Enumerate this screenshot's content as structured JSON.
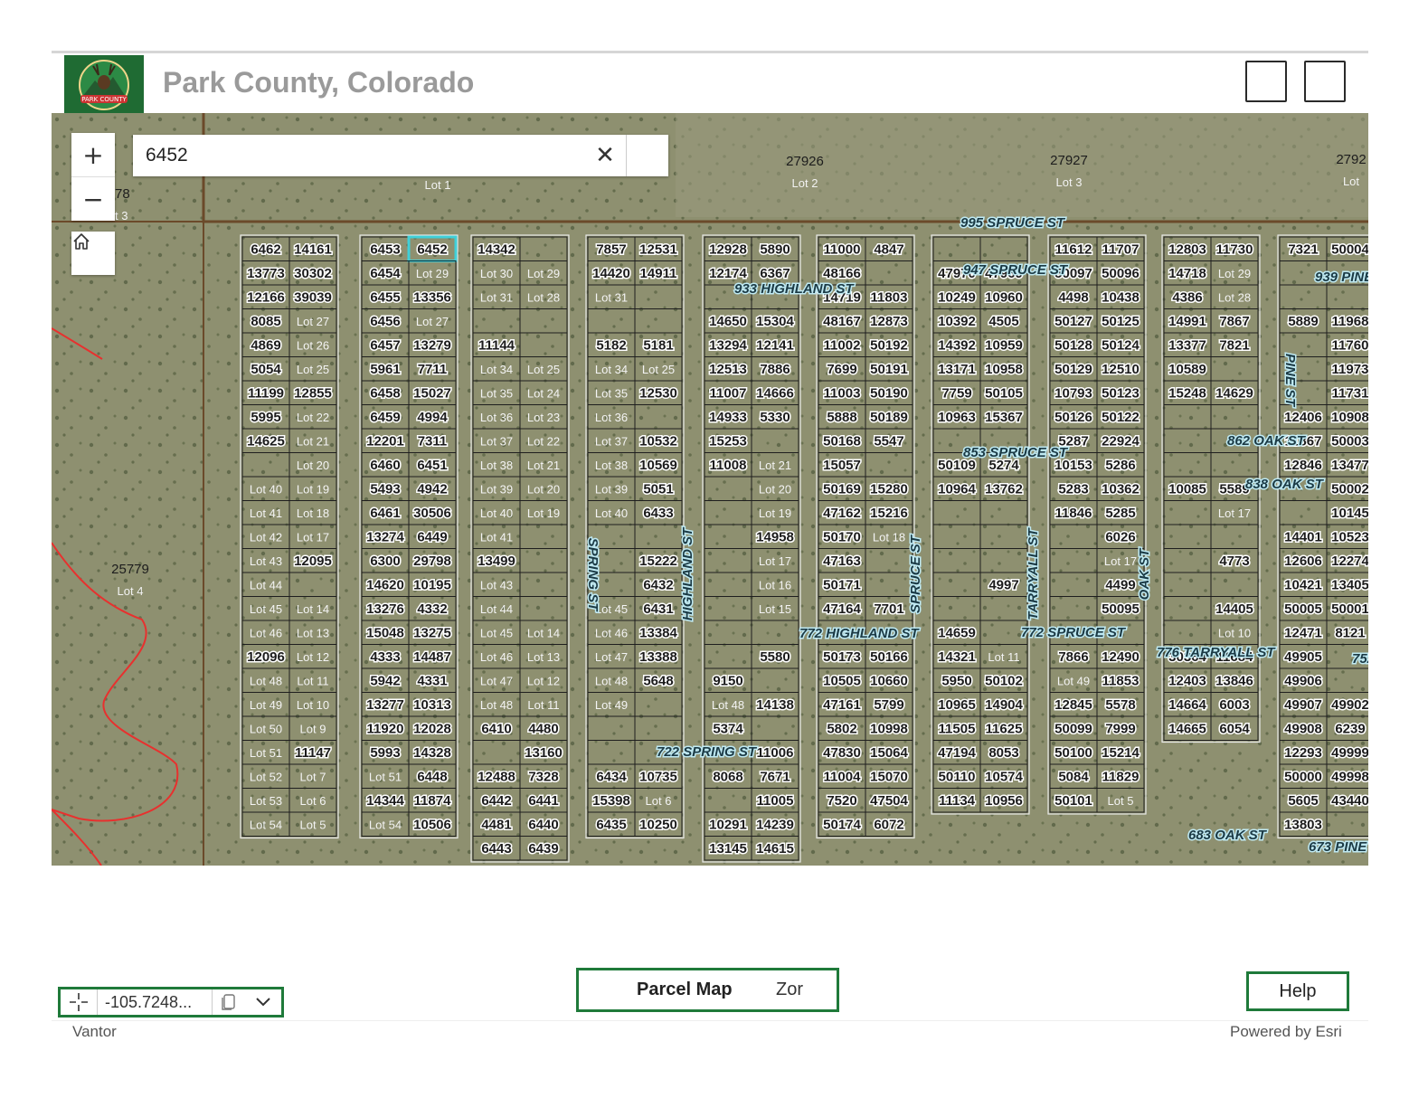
{
  "header": {
    "title": "Park County, Colorado",
    "logo_text": "PARK COUNTY"
  },
  "map": {
    "search": {
      "value": "6452",
      "placeholder": ""
    },
    "zoom_in_label": "+",
    "zoom_out_label": "−",
    "parcels_large": [
      {
        "id": "27926",
        "lot": "Lot 2"
      },
      {
        "id": "27927",
        "lot": "Lot 3"
      },
      {
        "id": "2792",
        "lot": "Lot"
      },
      {
        "id": "",
        "lot": "Lot 1"
      },
      {
        "id": "5778",
        "lot": "Lot 3"
      },
      {
        "id": "25779",
        "lot": "Lot 4"
      }
    ],
    "streets": [
      "995 SPRUCE ST",
      "947 SPRUCE ST",
      "933 HIGHLAND ST",
      "939 PINE ST",
      "862 OAK ST",
      "853 SPRUCE ST",
      "838 OAK ST",
      "772 HIGHLAND ST",
      "772 SPRUCE ST",
      "776 TARRYALL ST",
      "752 P",
      "722 SPRING ST",
      "683 OAK ST",
      "673 PINE ST",
      "SPRING ST",
      "HIGHLAND ST",
      "SPRUCE ST",
      "TARRYALL ST",
      "OAK ST",
      "PINE ST"
    ],
    "selected_parcel": "6452",
    "blocks": [
      {
        "cols": 2,
        "rows": [
          [
            "6462",
            "14161"
          ],
          [
            "13773",
            "30302"
          ],
          [
            "12166",
            "39039"
          ],
          [
            "8085",
            "Lot 27"
          ],
          [
            "4869",
            "Lot 26"
          ],
          [
            "5054",
            "Lot 25"
          ],
          [
            "11199",
            "12855"
          ],
          [
            "5995",
            "Lot 22"
          ],
          [
            "14625",
            "Lot 21"
          ],
          [
            "",
            "Lot 20"
          ],
          [
            "Lot 40",
            "Lot 19"
          ],
          [
            "Lot 41",
            "Lot 18"
          ],
          [
            "Lot 42",
            "Lot 17"
          ],
          [
            "Lot 43",
            "12095"
          ],
          [
            "Lot 44",
            ""
          ],
          [
            "Lot 45",
            "Lot 14"
          ],
          [
            "Lot 46",
            "Lot 13"
          ],
          [
            "12096",
            "Lot 12"
          ],
          [
            "Lot 48",
            "Lot 11"
          ],
          [
            "Lot 49",
            "Lot 10"
          ],
          [
            "Lot 50",
            "Lot 9"
          ],
          [
            "Lot 51",
            "11147"
          ],
          [
            "Lot 52",
            "Lot 7"
          ],
          [
            "Lot 53",
            "Lot 6"
          ],
          [
            "Lot 54",
            "Lot 5"
          ]
        ]
      },
      {
        "cols": 2,
        "rows": [
          [
            "6453",
            "6452"
          ],
          [
            "6454",
            "Lot 29"
          ],
          [
            "6455",
            "13356"
          ],
          [
            "6456",
            "Lot 27"
          ],
          [
            "6457",
            "13279"
          ],
          [
            "5961",
            "7711"
          ],
          [
            "6458",
            "15027"
          ],
          [
            "6459",
            "4994"
          ],
          [
            "12201",
            "7311"
          ],
          [
            "6460",
            "6451"
          ],
          [
            "5493",
            "4942"
          ],
          [
            "6461",
            "30506"
          ],
          [
            "13274",
            "6449"
          ],
          [
            "6300",
            "29798"
          ],
          [
            "14620",
            "10195"
          ],
          [
            "13276",
            "4332"
          ],
          [
            "15048",
            "13275"
          ],
          [
            "4333",
            "14487"
          ],
          [
            "5942",
            "4331"
          ],
          [
            "13277",
            "10313"
          ],
          [
            "11920",
            "12028"
          ],
          [
            "5993",
            "14328"
          ],
          [
            "Lot 51",
            "6448"
          ],
          [
            "14344",
            "11874"
          ],
          [
            "Lot 54",
            "10506"
          ]
        ]
      },
      {
        "cols": 2,
        "rows": [
          [
            "14342",
            ""
          ],
          [
            "Lot 30",
            "Lot 29"
          ],
          [
            "Lot 31",
            "Lot 28"
          ],
          [
            "",
            ""
          ],
          [
            "11144",
            ""
          ],
          [
            "Lot 34",
            "Lot 25"
          ],
          [
            "Lot 35",
            "Lot 24"
          ],
          [
            "Lot 36",
            "Lot 23"
          ],
          [
            "Lot 37",
            "Lot 22"
          ],
          [
            "Lot 38",
            "Lot 21"
          ],
          [
            "Lot 39",
            "Lot 20"
          ],
          [
            "Lot 40",
            "Lot 19"
          ],
          [
            "Lot 41",
            ""
          ],
          [
            "13499",
            ""
          ],
          [
            "Lot 43",
            ""
          ],
          [
            "Lot 44",
            ""
          ],
          [
            "Lot 45",
            "Lot 14"
          ],
          [
            "Lot 46",
            "Lot 13"
          ],
          [
            "Lot 47",
            "Lot 12"
          ],
          [
            "Lot 48",
            "Lot 11"
          ],
          [
            "6410",
            "4480"
          ],
          [
            "",
            "13160"
          ],
          [
            "12488",
            "7328"
          ],
          [
            "6442",
            "6441"
          ],
          [
            "4481",
            "6440"
          ],
          [
            "6443",
            "6439"
          ]
        ]
      },
      {
        "cols": 2,
        "rows": [
          [
            "7857",
            "12531"
          ],
          [
            "14420",
            "14911"
          ],
          [
            "Lot 31",
            ""
          ],
          [
            "",
            ""
          ],
          [
            "5182",
            "5181"
          ],
          [
            "Lot 34",
            "Lot 25"
          ],
          [
            "Lot 35",
            "12530"
          ],
          [
            "Lot 36",
            ""
          ],
          [
            "Lot 37",
            "10532"
          ],
          [
            "Lot 38",
            "10569"
          ],
          [
            "Lot 39",
            "5051"
          ],
          [
            "Lot 40",
            "6433"
          ],
          [
            "",
            ""
          ],
          [
            "",
            "15222"
          ],
          [
            "",
            "6432"
          ],
          [
            "Lot 45",
            "6431"
          ],
          [
            "Lot 46",
            "13384"
          ],
          [
            "Lot 47",
            "13388"
          ],
          [
            "Lot 48",
            "5648"
          ],
          [
            "Lot 49",
            ""
          ],
          [
            "",
            ""
          ],
          [
            "",
            ""
          ],
          [
            "6434",
            "10735"
          ],
          [
            "15398",
            "Lot 6"
          ],
          [
            "6435",
            "10250"
          ]
        ]
      },
      {
        "cols": 2,
        "rows": [
          [
            "12928",
            "5890"
          ],
          [
            "12174",
            "6367"
          ],
          [
            "",
            ""
          ],
          [
            "14650",
            "15304"
          ],
          [
            "13294",
            "12141"
          ],
          [
            "12513",
            "7886"
          ],
          [
            "11007",
            "14666"
          ],
          [
            "14933",
            "5330"
          ],
          [
            "15253",
            ""
          ],
          [
            "11008",
            "Lot 21"
          ],
          [
            "",
            "Lot 20"
          ],
          [
            "",
            "Lot 19"
          ],
          [
            "",
            "14958"
          ],
          [
            "",
            "Lot 17"
          ],
          [
            "",
            "Lot 16"
          ],
          [
            "",
            "Lot 15"
          ],
          [
            "",
            ""
          ],
          [
            "",
            "5580"
          ],
          [
            "9150",
            ""
          ],
          [
            "Lot 48",
            "14138"
          ],
          [
            "5374",
            ""
          ],
          [
            "",
            "11006"
          ],
          [
            "8068",
            "7671"
          ],
          [
            "",
            "11005"
          ],
          [
            "10291",
            "14239"
          ],
          [
            "13145",
            "14615"
          ]
        ]
      },
      {
        "cols": 2,
        "rows": [
          [
            "11000",
            "4847"
          ],
          [
            "48166",
            ""
          ],
          [
            "14719",
            "11803"
          ],
          [
            "48167",
            "12873"
          ],
          [
            "11002",
            "50192"
          ],
          [
            "7699",
            "50191"
          ],
          [
            "11003",
            "50190"
          ],
          [
            "5888",
            "50189"
          ],
          [
            "50168",
            "5547"
          ],
          [
            "15057",
            ""
          ],
          [
            "50169",
            "15280"
          ],
          [
            "47162",
            "15216"
          ],
          [
            "50170",
            "Lot 18"
          ],
          [
            "47163",
            ""
          ],
          [
            "50171",
            ""
          ],
          [
            "47164",
            "7701"
          ],
          [
            "",
            ""
          ],
          [
            "50173",
            "50166"
          ],
          [
            "10505",
            "10660"
          ],
          [
            "47161",
            "5799"
          ],
          [
            "5802",
            "10998"
          ],
          [
            "47830",
            "15064"
          ],
          [
            "11004",
            "15070"
          ],
          [
            "7520",
            "47504"
          ],
          [
            "50174",
            "6072"
          ]
        ]
      },
      {
        "cols": 2,
        "rows": [
          [
            "",
            ""
          ],
          [
            "47970",
            "47969"
          ],
          [
            "10249",
            "10960"
          ],
          [
            "10392",
            "4505"
          ],
          [
            "14392",
            "10959"
          ],
          [
            "13171",
            "10958"
          ],
          [
            "7759",
            "50105"
          ],
          [
            "10963",
            "15367"
          ],
          [
            "",
            ""
          ],
          [
            "50109",
            "5274"
          ],
          [
            "10964",
            "13762"
          ],
          [
            "",
            ""
          ],
          [
            "",
            ""
          ],
          [
            "",
            ""
          ],
          [
            "",
            "4997"
          ],
          [
            "",
            ""
          ],
          [
            "14659",
            ""
          ],
          [
            "14321",
            "Lot 11"
          ],
          [
            "5950",
            "50102"
          ],
          [
            "10965",
            "14904"
          ],
          [
            "11505",
            "11625"
          ],
          [
            "47194",
            "8053"
          ],
          [
            "50110",
            "10574"
          ],
          [
            "11134",
            "10956"
          ]
        ]
      },
      {
        "cols": 2,
        "rows": [
          [
            "11612",
            "11707"
          ],
          [
            "50097",
            "50096"
          ],
          [
            "4498",
            "10438"
          ],
          [
            "50127",
            "50125"
          ],
          [
            "50128",
            "50124"
          ],
          [
            "50129",
            "12510"
          ],
          [
            "10793",
            "50123"
          ],
          [
            "50126",
            "50122"
          ],
          [
            "5287",
            "22924"
          ],
          [
            "10153",
            "5286"
          ],
          [
            "5283",
            "10362"
          ],
          [
            "11846",
            "5285"
          ],
          [
            "",
            "6026"
          ],
          [
            "",
            "Lot 17"
          ],
          [
            "",
            "4499"
          ],
          [
            "",
            "50095"
          ],
          [
            "",
            ""
          ],
          [
            "7866",
            "12490"
          ],
          [
            "Lot 49",
            "11853"
          ],
          [
            "12845",
            "5578"
          ],
          [
            "50099",
            "7999"
          ],
          [
            "50100",
            "15214"
          ],
          [
            "5084",
            "11829"
          ],
          [
            "50101",
            "Lot 5"
          ]
        ]
      },
      {
        "cols": 2,
        "rows": [
          [
            "12803",
            "11730"
          ],
          [
            "14718",
            "Lot 29"
          ],
          [
            "4386",
            "Lot 28"
          ],
          [
            "14991",
            "7867"
          ],
          [
            "13377",
            "7821"
          ],
          [
            "10589",
            ""
          ],
          [
            "15248",
            "14629"
          ],
          [
            "",
            ""
          ],
          [
            "",
            ""
          ],
          [
            "",
            ""
          ],
          [
            "10085",
            "5589"
          ],
          [
            "",
            "Lot 17"
          ],
          [
            "",
            ""
          ],
          [
            "",
            "4773"
          ],
          [
            "",
            ""
          ],
          [
            "",
            "14405"
          ],
          [
            "",
            "Lot 10"
          ],
          [
            "30364",
            "11684"
          ],
          [
            "12403",
            "13846"
          ],
          [
            "14664",
            "6003"
          ],
          [
            "14665",
            "6054"
          ]
        ]
      },
      {
        "cols": 2,
        "rows": [
          [
            "7321",
            "50004"
          ],
          [
            "",
            ""
          ],
          [
            "",
            ""
          ],
          [
            "5889",
            "11968"
          ],
          [
            "",
            "11760"
          ],
          [
            "",
            "11973"
          ],
          [
            "",
            "11731"
          ],
          [
            "12406",
            "10908"
          ],
          [
            "11867",
            "50003"
          ],
          [
            "12846",
            "13477"
          ],
          [
            "",
            "50002"
          ],
          [
            "",
            "10145"
          ],
          [
            "14401",
            "10523"
          ],
          [
            "12606",
            "12274"
          ],
          [
            "10421",
            "13405"
          ],
          [
            "50005",
            "50001"
          ],
          [
            "12471",
            "8121"
          ],
          [
            "49905",
            ""
          ],
          [
            "49906",
            ""
          ],
          [
            "49907",
            "49902"
          ],
          [
            "49908",
            "6239"
          ],
          [
            "12293",
            "49999"
          ],
          [
            "50000",
            "49998"
          ],
          [
            "5605",
            "43440"
          ],
          [
            "13803",
            ""
          ]
        ]
      }
    ]
  },
  "footer": {
    "coordinate": "-105.7248...",
    "tabs": [
      "Parcel Map",
      "Zor"
    ],
    "help_label": "Help",
    "attribution_left": "Vantor",
    "attribution_right": "Powered by Esri"
  },
  "colors": {
    "brand_green": "#1f7a3a",
    "selected_outline": "#3fd0d8",
    "parcel_line": "#1e1e1e",
    "label_fill": "#ffffff",
    "street_label": "#bfe9f2",
    "boundary": "#e8302e"
  }
}
